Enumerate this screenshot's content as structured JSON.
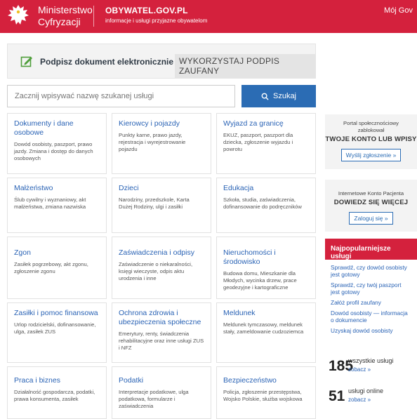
{
  "header": {
    "ministry_line1": "Ministerstwo",
    "ministry_line2": "Cyfryzacji",
    "site_title": "OBYWATEL.GOV.PL",
    "site_subtitle": "informacje i usługi przyjazne obywatelom",
    "my_gov": "Mój Gov"
  },
  "sign": {
    "text": "Podpisz dokument elektronicznie »",
    "button": "WYKORZYSTAJ PODPIS ZAUFANY"
  },
  "search": {
    "placeholder": "Zacznij wpisywać nazwę szukanej usługi",
    "button": "Szukaj"
  },
  "categories": [
    {
      "title": "Dokumenty i dane osobowe",
      "desc": "Dowód osobisty, paszport, prawo jazdy. Zmiana i dostęp do danych osobowych"
    },
    {
      "title": "Kierowcy i pojazdy",
      "desc": "Punkty karne, prawo jazdy, rejestracja i wyrejestrowanie pojazdu"
    },
    {
      "title": "Wyjazd za granicę",
      "desc": "EKUZ, paszport, paszport dla dziecka, zgłoszenie wyjazdu i powrotu"
    },
    {
      "title": "Małżeństwo",
      "desc": "Ślub cywilny i wyznaniowy, akt małżeństwa, zmiana nazwiska"
    },
    {
      "title": "Dzieci",
      "desc": "Narodziny, przedszkole, Karta Dużej Rodziny, ulgi i zasiłki"
    },
    {
      "title": "Edukacja",
      "desc": "Szkoła, studia, zaświadczenia, dofinansowanie do podręczników"
    },
    {
      "title": "Zgon",
      "desc": "Zasiłek pogrzebowy, akt zgonu, zgłoszenie zgonu"
    },
    {
      "title": "Zaświadczenia i odpisy",
      "desc": "Zaświadczenie o niekaralności, księgi wieczyste, odpis aktu urodzenia i inne"
    },
    {
      "title": "Nieruchomości i środowisko",
      "desc": "Budowa domu, Mieszkanie dla Młodych, wycinka drzew, prace geodezyjne i kartograficzne"
    },
    {
      "title": "Zasiłki i pomoc finansowa",
      "desc": "Urlop rodzicielski, dofinansowanie, ulga, zasiłek ZUS"
    },
    {
      "title": "Ochrona zdrowia i ubezpieczenia społeczne",
      "desc": "Emerytury, renty, świadczenia rehabilitacyjne oraz inne usługi ZUS i NFZ"
    },
    {
      "title": "Meldunek",
      "desc": "Meldunek tymczasowy, meldunek stały, zameldowanie cudzoziemca"
    },
    {
      "title": "Praca i biznes",
      "desc": "Działalność gospodarcza, podatki, prawa konsumenta, zasiłek"
    },
    {
      "title": "Podatki",
      "desc": "Interpretacje podatkowe, ulga podatkowa, formularze i zaświadczenia"
    },
    {
      "title": "Bezpieczeństwo",
      "desc": "Policja, zgłoszenie przestępstwa, Wojsko Polskie, służba wojskowa"
    }
  ],
  "side": {
    "portal": {
      "line1": "Portal społecznościowy zablokował",
      "strong": "TWOJE KONTO LUB WPISY",
      "button": "Wyślij zgłoszenie »"
    },
    "ikp": {
      "line1": "Internetowe Konto Pacjenta",
      "strong": "DOWIEDZ SIĘ WIĘCEJ",
      "button": "Zaloguj się »"
    },
    "popular_title": "Najpopularniejsze usługi",
    "popular": [
      "Sprawdź, czy dowód osobisty jest gotowy",
      "Sprawdź, czy twój paszport jest gotowy",
      "Załóż profil zaufany",
      "Dowód osobisty — informacja o dokumencie",
      "Uzyskaj dowód osobisty"
    ],
    "stats": [
      {
        "num": "185",
        "label": "wszystkie usługi",
        "link": "zobacz »"
      },
      {
        "num": "51",
        "label": "usługi online",
        "link": "zobacz »"
      }
    ]
  },
  "colors": {
    "brand_red": "#d4213d",
    "link_blue": "#2a63b5",
    "button_blue": "#2b6cb4"
  }
}
